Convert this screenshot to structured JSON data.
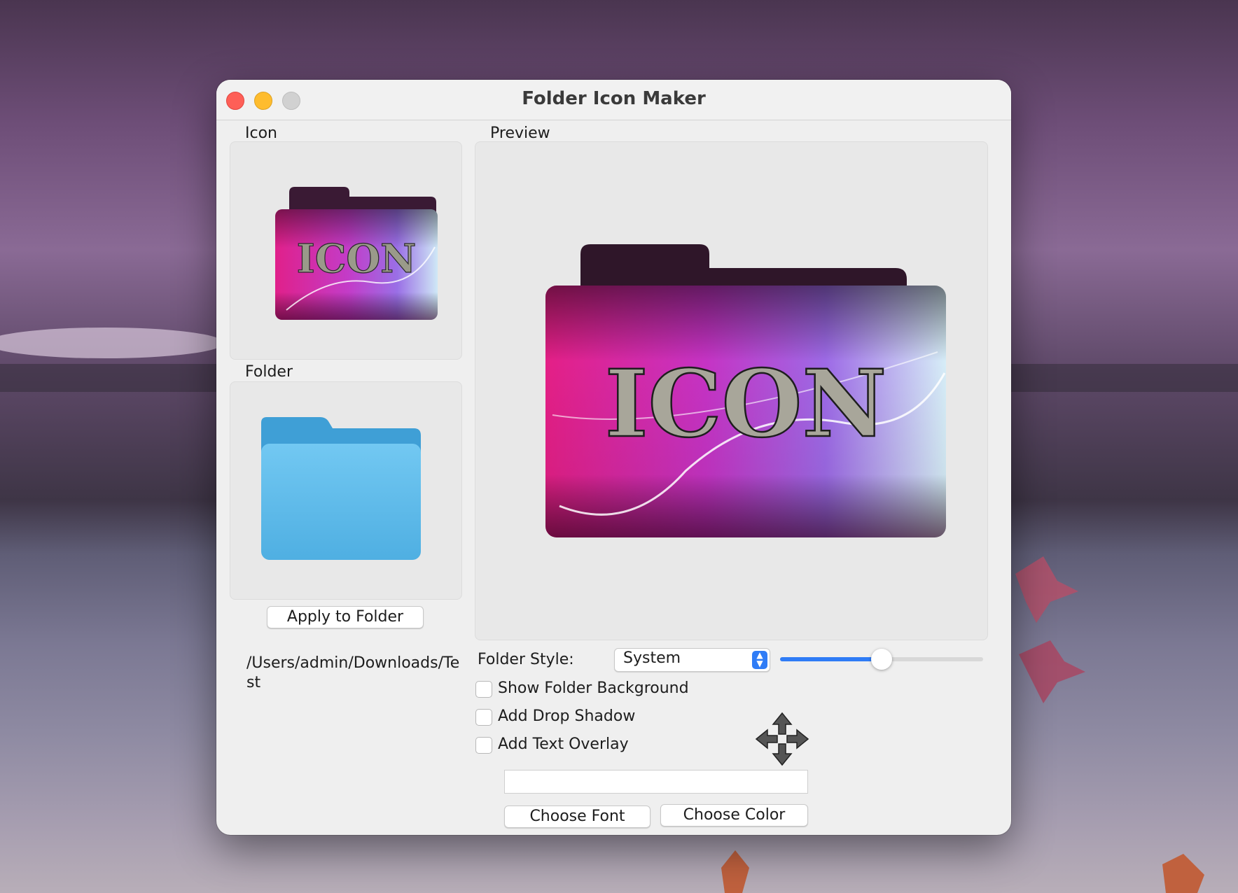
{
  "window": {
    "title": "Folder Icon Maker"
  },
  "left": {
    "icon_label": "Icon",
    "folder_label": "Folder",
    "apply_button": "Apply to Folder",
    "path": "/Users/admin/Downloads/Test"
  },
  "preview": {
    "label": "Preview",
    "icon_text": "ICON"
  },
  "controls": {
    "folder_style_label": "Folder Style:",
    "folder_style_value": "System",
    "slider_fraction": 0.5,
    "checkboxes": [
      {
        "label": "Show Folder Background",
        "checked": false
      },
      {
        "label": "Add Drop Shadow",
        "checked": false
      },
      {
        "label": "Add Text Overlay",
        "checked": false
      }
    ],
    "text_overlay_value": "",
    "choose_font": "Choose Font",
    "choose_color": "Choose Color"
  },
  "colors": {
    "accent": "#2f7cf6",
    "folder_blue": "#5fb8ea",
    "close": "#fe5f57",
    "minimize": "#febc2e"
  }
}
